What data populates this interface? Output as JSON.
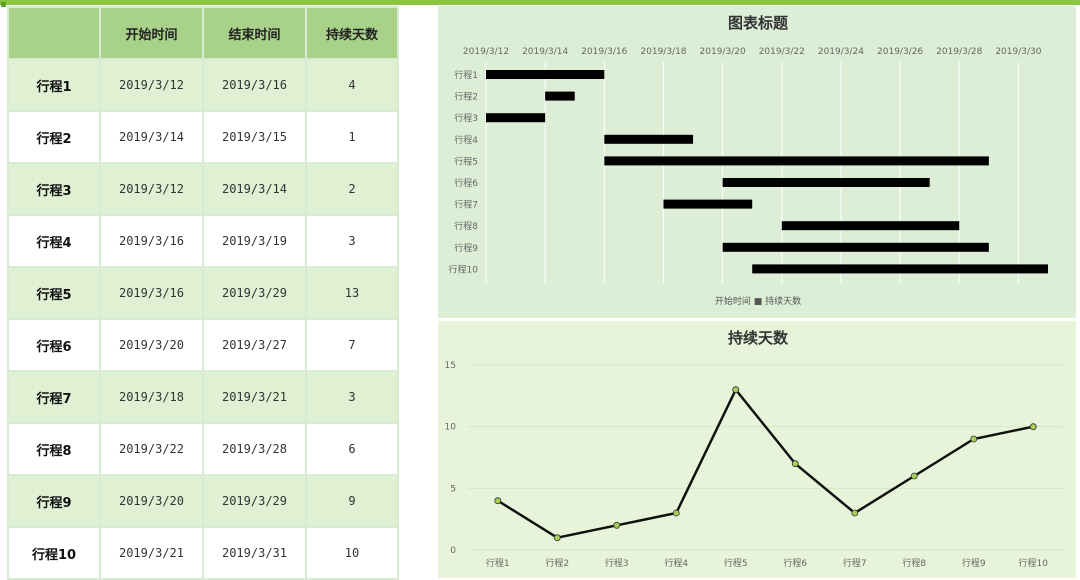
{
  "table": {
    "headers": [
      "",
      "开始时间",
      "结束时间",
      "持续天数"
    ],
    "rows": [
      {
        "name": "行程1",
        "start": "2019/3/12",
        "end": "2019/3/16",
        "days": "4"
      },
      {
        "name": "行程2",
        "start": "2019/3/14",
        "end": "2019/3/15",
        "days": "1"
      },
      {
        "name": "行程3",
        "start": "2019/3/12",
        "end": "2019/3/14",
        "days": "2"
      },
      {
        "name": "行程4",
        "start": "2019/3/16",
        "end": "2019/3/19",
        "days": "3"
      },
      {
        "name": "行程5",
        "start": "2019/3/16",
        "end": "2019/3/29",
        "days": "13"
      },
      {
        "name": "行程6",
        "start": "2019/3/20",
        "end": "2019/3/27",
        "days": "7"
      },
      {
        "name": "行程7",
        "start": "2019/3/18",
        "end": "2019/3/21",
        "days": "3"
      },
      {
        "name": "行程8",
        "start": "2019/3/22",
        "end": "2019/3/28",
        "days": "6"
      },
      {
        "name": "行程9",
        "start": "2019/3/20",
        "end": "2019/3/29",
        "days": "9"
      },
      {
        "name": "行程10",
        "start": "2019/3/21",
        "end": "2019/3/31",
        "days": "10"
      }
    ]
  },
  "chart_data": [
    {
      "type": "bar",
      "orientation": "horizontal-stacked-gantt",
      "title": "图表标题",
      "categories": [
        "行程1",
        "行程2",
        "行程3",
        "行程4",
        "行程5",
        "行程6",
        "行程7",
        "行程8",
        "行程9",
        "行程10"
      ],
      "x_tick_labels": [
        "2019/3/12",
        "2019/3/14",
        "2019/3/16",
        "2019/3/18",
        "2019/3/20",
        "2019/3/22",
        "2019/3/24",
        "2019/3/26",
        "2019/3/28",
        "2019/3/30"
      ],
      "x_axis_position": "top",
      "xlim": [
        "2019/3/12",
        "2019/3/31"
      ],
      "grid": true,
      "legend_position": "bottom",
      "legend_text": "开始时间 ■ 持续天数",
      "series": [
        {
          "name": "开始时间",
          "visible": false,
          "values": [
            "2019/3/12",
            "2019/3/14",
            "2019/3/12",
            "2019/3/16",
            "2019/3/16",
            "2019/3/20",
            "2019/3/18",
            "2019/3/22",
            "2019/3/20",
            "2019/3/21"
          ]
        },
        {
          "name": "持续天数",
          "color": "#000000",
          "values": [
            4,
            1,
            2,
            3,
            13,
            7,
            3,
            6,
            9,
            10
          ]
        }
      ]
    },
    {
      "type": "line",
      "title": "持续天数",
      "categories": [
        "行程1",
        "行程2",
        "行程3",
        "行程4",
        "行程5",
        "行程6",
        "行程7",
        "行程8",
        "行程9",
        "行程10"
      ],
      "y_ticks": [
        "0",
        "5",
        "10",
        "15"
      ],
      "ylim": [
        0,
        15
      ],
      "grid": true,
      "series": [
        {
          "name": "持续天数",
          "values": [
            4,
            1,
            2,
            3,
            13,
            7,
            3,
            6,
            9,
            10
          ],
          "color": "#111111",
          "marker_color": "#a6cf55"
        }
      ]
    }
  ]
}
